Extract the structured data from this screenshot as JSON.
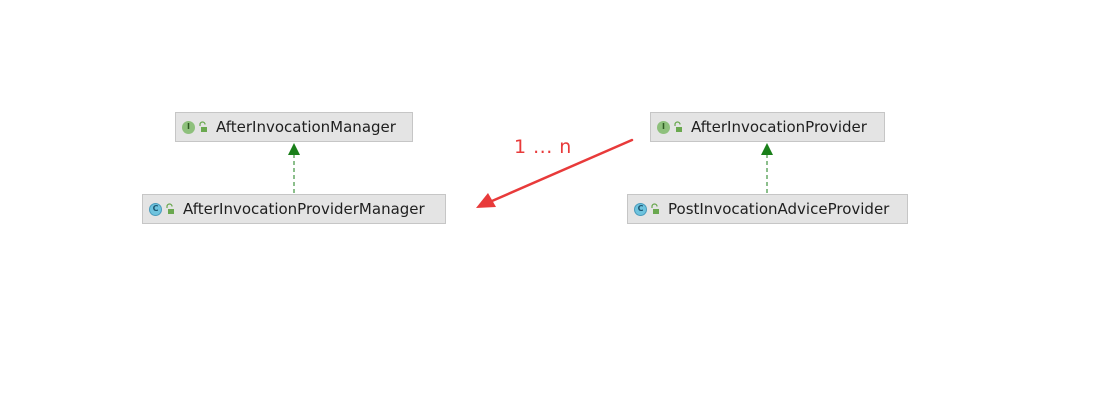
{
  "nodes": [
    {
      "id": "after_invocation_manager",
      "label": "AfterInvocationManager",
      "kind": "interface",
      "badge": "I"
    },
    {
      "id": "after_invocation_provider_manager",
      "label": "AfterInvocationProviderManager",
      "kind": "class",
      "badge": "C"
    },
    {
      "id": "after_invocation_provider",
      "label": "AfterInvocationProvider",
      "kind": "interface",
      "badge": "I"
    },
    {
      "id": "post_invocation_advice_provider",
      "label": "PostInvocationAdviceProvider",
      "kind": "class",
      "badge": "C"
    }
  ],
  "edges": [
    {
      "from": "after_invocation_provider_manager",
      "to": "after_invocation_manager",
      "type": "implements"
    },
    {
      "from": "post_invocation_advice_provider",
      "to": "after_invocation_provider",
      "type": "implements"
    },
    {
      "from": "after_invocation_provider",
      "to": "after_invocation_provider_manager",
      "type": "annotation-arrow"
    }
  ],
  "annotation": {
    "text": "1 ... n"
  },
  "colors": {
    "implements": "#1a7f1a",
    "annotation": "#e83a3a",
    "node_bg": "#e4e4e4",
    "node_border": "#c6c6c6"
  },
  "icons": {
    "interface": "interface-icon",
    "class": "class-icon",
    "access": "public-access-icon"
  }
}
